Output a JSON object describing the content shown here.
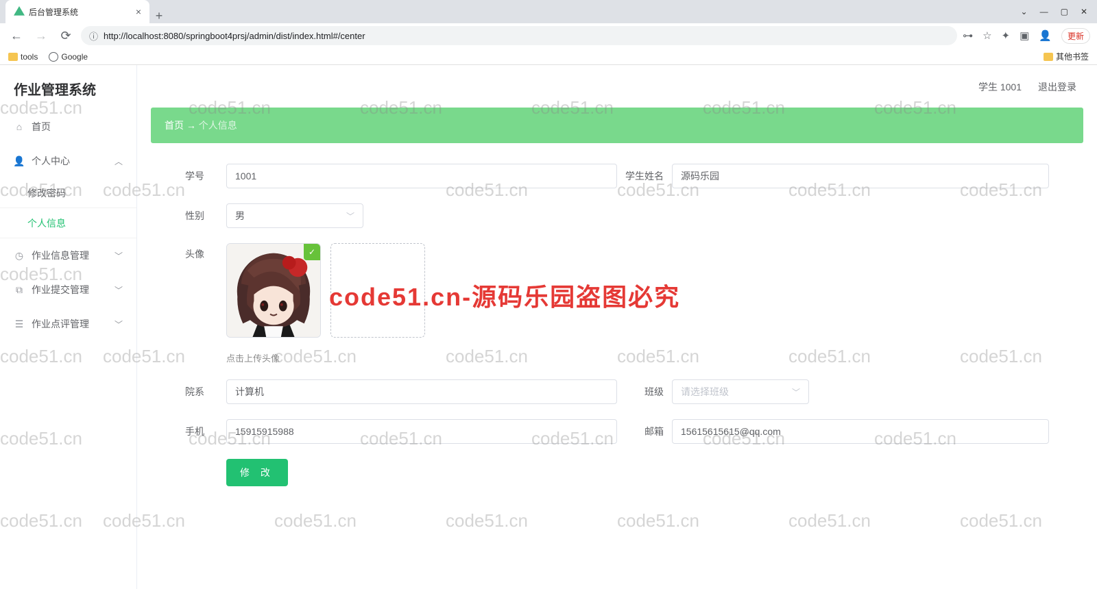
{
  "browser": {
    "tab_title": "后台管理系统",
    "url": "http://localhost:8080/springboot4prsj/admin/dist/index.html#/center",
    "bookmarks": {
      "tools": "tools",
      "google": "Google",
      "other": "其他书签"
    },
    "update_label": "更新"
  },
  "app": {
    "title": "作业管理系统",
    "topbar": {
      "user_role": "学生 1001",
      "logout": "退出登录"
    },
    "menu": {
      "home": "首页",
      "personal_center": "个人中心",
      "change_password": "修改密码",
      "personal_info": "个人信息",
      "homework_info": "作业信息管理",
      "homework_submit": "作业提交管理",
      "homework_review": "作业点评管理"
    },
    "breadcrumb": {
      "home": "首页",
      "arrow": "→",
      "current": "个人信息"
    }
  },
  "form": {
    "labels": {
      "student_no": "学号",
      "student_name": "学生姓名",
      "gender": "性别",
      "avatar": "头像",
      "department": "院系",
      "class": "班级",
      "phone": "手机",
      "email": "邮箱"
    },
    "values": {
      "student_no": "1001",
      "student_name": "源码乐园",
      "gender": "男",
      "department": "计算机",
      "phone": "15915915988",
      "email": "15615615615@qq.com"
    },
    "placeholders": {
      "class": "请选择班级"
    },
    "upload_hint": "点击上传头像",
    "submit": "修 改"
  },
  "watermark": {
    "text": "code51.cn",
    "banner": "code51.cn-源码乐园盗图必究"
  }
}
